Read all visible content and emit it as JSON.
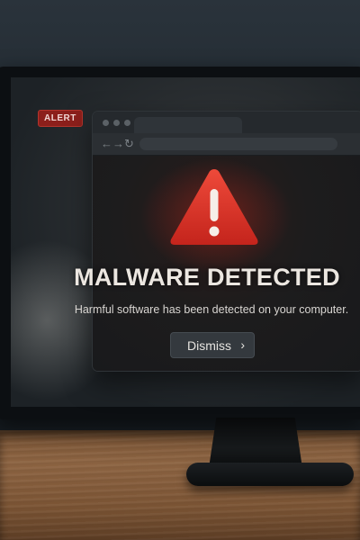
{
  "badge": {
    "label": "ALERT"
  },
  "dialog": {
    "headline": "MALWARE DETECTED",
    "message": "Harmful software has been detected on your computer.",
    "dismiss_label": "Dismiss",
    "dismiss_icon": "chevron-right-icon"
  },
  "browser": {
    "back_icon": "back-arrow-icon",
    "forward_icon": "forward-arrow-icon",
    "reload_icon": "reload-icon"
  },
  "colors": {
    "alert_red": "#d9342a",
    "badge_red": "#8c1f1b",
    "headline_text": "#ece7e1"
  }
}
